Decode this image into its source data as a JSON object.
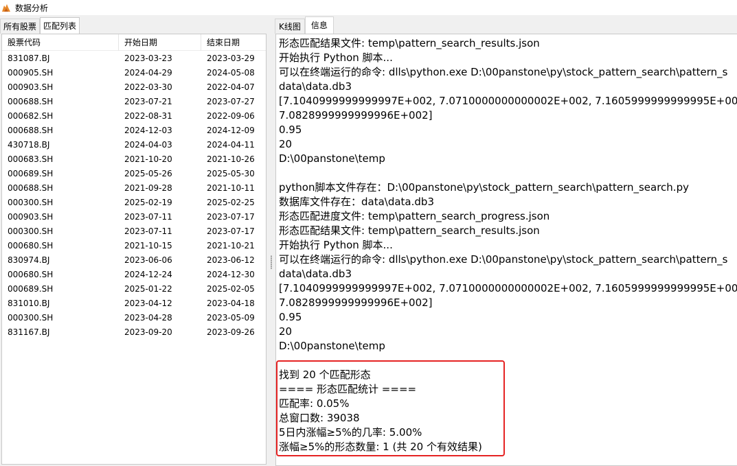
{
  "window": {
    "title": "数据分析",
    "icon": "fox-logo-icon"
  },
  "left_panel": {
    "tabs": [
      {
        "label": "所有股票",
        "active": false
      },
      {
        "label": "匹配列表",
        "active": true
      }
    ],
    "columns": [
      "股票代码",
      "开始日期",
      "结束日期"
    ],
    "rows": [
      [
        "831087.BJ",
        "2023-03-23",
        "2023-03-29"
      ],
      [
        "000905.SH",
        "2024-04-29",
        "2024-05-08"
      ],
      [
        "000903.SH",
        "2022-03-30",
        "2022-04-07"
      ],
      [
        "000688.SH",
        "2023-07-21",
        "2023-07-27"
      ],
      [
        "000682.SH",
        "2022-08-31",
        "2022-09-06"
      ],
      [
        "000688.SH",
        "2024-12-03",
        "2024-12-09"
      ],
      [
        "430718.BJ",
        "2024-04-03",
        "2024-04-11"
      ],
      [
        "000683.SH",
        "2021-10-20",
        "2021-10-26"
      ],
      [
        "000689.SH",
        "2025-05-26",
        "2025-05-30"
      ],
      [
        "000688.SH",
        "2021-09-28",
        "2021-10-11"
      ],
      [
        "000300.SH",
        "2025-02-19",
        "2025-02-25"
      ],
      [
        "000903.SH",
        "2023-07-11",
        "2023-07-17"
      ],
      [
        "000300.SH",
        "2023-07-11",
        "2023-07-17"
      ],
      [
        "000680.SH",
        "2021-10-15",
        "2021-10-21"
      ],
      [
        "830974.BJ",
        "2023-06-06",
        "2023-06-12"
      ],
      [
        "000680.SH",
        "2024-12-24",
        "2024-12-30"
      ],
      [
        "000689.SH",
        "2025-01-22",
        "2025-02-05"
      ],
      [
        "831010.BJ",
        "2023-04-12",
        "2023-04-18"
      ],
      [
        "000300.SH",
        "2023-04-28",
        "2023-05-09"
      ],
      [
        "831167.BJ",
        "2023-09-20",
        "2023-09-26"
      ]
    ]
  },
  "right_panel": {
    "tabs": [
      {
        "label": "K线图",
        "active": false
      },
      {
        "label": "信息",
        "active": true
      }
    ],
    "log_lines": [
      "形态匹配结果文件: temp\\pattern_search_results.json",
      "开始执行 Python 脚本...",
      "可以在终端运行的命令: dlls\\python.exe D:\\00panstone\\py\\stock_pattern_search\\pattern_s",
      "data\\data.db3",
      "[7.1040999999999997E+002, 7.0710000000000002E+002, 7.1605999999999995E+002, 7.1",
      "7.0828999999999996E+002]",
      "0.95",
      "20",
      "D:\\00panstone\\temp",
      "",
      "python脚本文件存在：D:\\00panstone\\py\\stock_pattern_search\\pattern_search.py",
      "数据库文件存在：data\\data.db3",
      "形态匹配进度文件: temp\\pattern_search_progress.json",
      "形态匹配结果文件: temp\\pattern_search_results.json",
      "开始执行 Python 脚本...",
      "可以在终端运行的命令: dlls\\python.exe D:\\00panstone\\py\\stock_pattern_search\\pattern_s",
      "data\\data.db3",
      "[7.1040999999999997E+002, 7.0710000000000002E+002, 7.1605999999999995E+002, 7.1",
      "7.0828999999999996E+002]",
      "0.95",
      "20",
      "D:\\00panstone\\temp"
    ],
    "stats_lines": [
      "找到 20 个匹配形态",
      "==== 形态匹配统计 ====",
      "匹配率: 0.05%",
      "总窗口数: 39038",
      "5日内涨幅≥5%的几率: 5.00%",
      "涨幅≥5%的形态数量: 1 (共 20 个有效结果)"
    ],
    "highlight_color": "#e52222"
  }
}
